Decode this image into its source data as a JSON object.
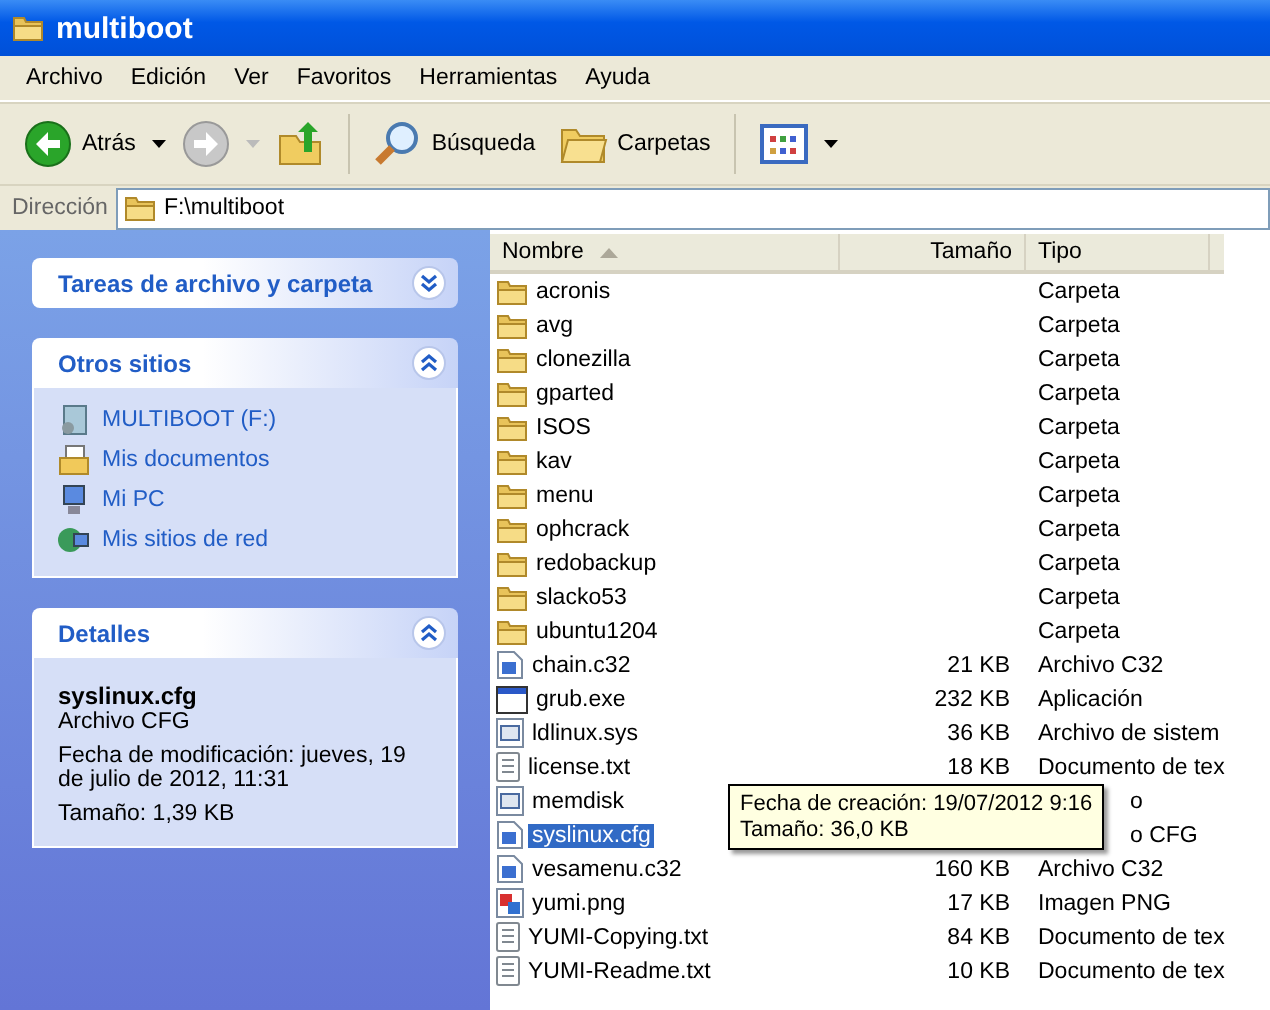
{
  "window": {
    "title": "multiboot"
  },
  "menu": [
    "Archivo",
    "Edición",
    "Ver",
    "Favoritos",
    "Herramientas",
    "Ayuda"
  ],
  "toolbar": [
    {
      "kind": "back",
      "label": "Atrás",
      "disabled": false
    },
    {
      "kind": "forward",
      "disabled": true
    },
    {
      "kind": "up"
    },
    {
      "kind": "search",
      "label": "Búsqueda"
    },
    {
      "kind": "folders",
      "label": "Carpetas"
    },
    {
      "kind": "views"
    }
  ],
  "address": {
    "label": "Dirección",
    "value": "F:\\multiboot"
  },
  "task_pane": [
    {
      "title": "Tareas de archivo y carpeta",
      "expanded": false
    },
    {
      "title": "Otros sitios",
      "expanded": true,
      "links": [
        {
          "label": "MULTIBOOT (F:)",
          "kind": "drive"
        },
        {
          "label": "Mis documentos",
          "kind": "documents"
        },
        {
          "label": "Mi PC",
          "kind": "computer"
        },
        {
          "label": "Mis sitios de red",
          "kind": "network"
        }
      ]
    },
    {
      "title": "Detalles",
      "expanded": true,
      "details": {
        "name": "syslinux.cfg",
        "type": "Archivo CFG",
        "modified": "Fecha de modificación: jueves, 19 de julio de 2012, 11:31",
        "size": "Tamaño: 1,39 KB"
      }
    }
  ],
  "file_list": {
    "columns": [
      {
        "label": "Nombre",
        "sorted": true
      },
      {
        "label": "Tamaño",
        "sorted": false
      },
      {
        "label": "Tipo",
        "sorted": false
      }
    ],
    "rows": [
      {
        "name": "acronis",
        "type": "Carpeta",
        "kind": "folder",
        "selected": false
      },
      {
        "name": "avg",
        "type": "Carpeta",
        "kind": "folder",
        "selected": false
      },
      {
        "name": "clonezilla",
        "type": "Carpeta",
        "kind": "folder",
        "selected": false
      },
      {
        "name": "gparted",
        "type": "Carpeta",
        "kind": "folder",
        "selected": false
      },
      {
        "name": "ISOS",
        "type": "Carpeta",
        "kind": "folder",
        "selected": false
      },
      {
        "name": "kav",
        "type": "Carpeta",
        "kind": "folder",
        "selected": false
      },
      {
        "name": "menu",
        "type": "Carpeta",
        "kind": "folder",
        "selected": false
      },
      {
        "name": "ophcrack",
        "type": "Carpeta",
        "kind": "folder",
        "selected": false
      },
      {
        "name": "redobackup",
        "type": "Carpeta",
        "kind": "folder",
        "selected": false
      },
      {
        "name": "slacko53",
        "type": "Carpeta",
        "kind": "folder",
        "selected": false
      },
      {
        "name": "ubuntu1204",
        "type": "Carpeta",
        "kind": "folder",
        "selected": false
      },
      {
        "name": "chain.c32",
        "size": "21 KB",
        "type": "Archivo C32",
        "kind": "c32",
        "selected": false
      },
      {
        "name": "grub.exe",
        "size": "232 KB",
        "type": "Aplicación",
        "kind": "exe",
        "selected": false
      },
      {
        "name": "ldlinux.sys",
        "size": "36 KB",
        "type": "Archivo de sistem",
        "kind": "sys",
        "selected": false
      },
      {
        "name": "license.txt",
        "size": "18 KB",
        "type": "Documento de tex",
        "kind": "txt",
        "selected": false
      },
      {
        "name": "memdisk",
        "type": "o",
        "kind": "sys",
        "selected": false,
        "under_tooltip": true
      },
      {
        "name": "syslinux.cfg",
        "type": "o CFG",
        "kind": "c32",
        "selected": true,
        "under_tooltip": true
      },
      {
        "name": "vesamenu.c32",
        "size": "160 KB",
        "type": "Archivo C32",
        "kind": "c32",
        "selected": false
      },
      {
        "name": "yumi.png",
        "size": "17 KB",
        "type": "Imagen PNG",
        "kind": "png",
        "selected": false
      },
      {
        "name": "YUMI-Copying.txt",
        "size": "84 KB",
        "type": "Documento de tex",
        "kind": "txt",
        "selected": false
      },
      {
        "name": "YUMI-Readme.txt",
        "size": "10 KB",
        "type": "Documento de tex",
        "kind": "txt",
        "selected": false
      }
    ],
    "tooltip": {
      "lines": [
        "Fecha de creación: 19/07/2012 9:16",
        "Tamaño: 36,0 KB"
      ]
    }
  }
}
